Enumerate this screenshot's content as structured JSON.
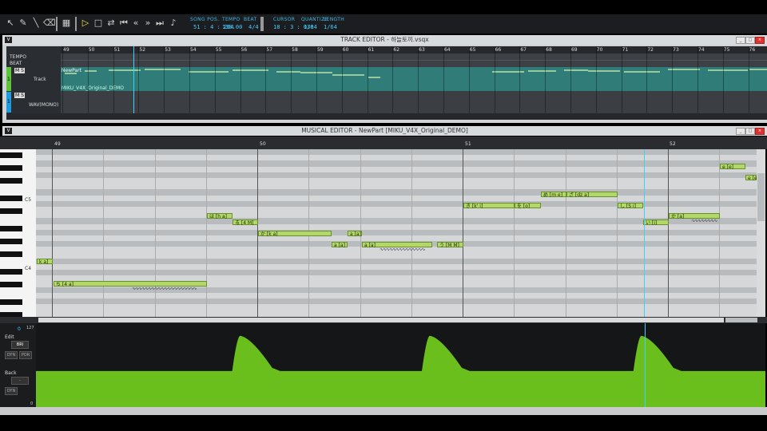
{
  "toolbar": {
    "song_pos_label": "SONG POS.",
    "song_pos_value": "51 : 4 : 264",
    "tempo_label": "TEMPO",
    "tempo_value": "130.00",
    "beat_label": "BEAT",
    "beat_value": "4/4",
    "cursor_label": "CURSOR",
    "cursor_value": "18 : 3 : 030",
    "quantize_label": "QUANTIZE",
    "quantize_value": "1/64",
    "length_label": "LENGTH",
    "length_value": "1/64",
    "icons": [
      "pointer-icon",
      "pencil-icon",
      "line-icon",
      "eraser-icon",
      "grid-icon",
      "play-icon",
      "stop-icon",
      "loop-icon",
      "rewind-icon",
      "back-icon",
      "forward-icon",
      "fast-forward-icon",
      "metronome-icon"
    ]
  },
  "track_editor": {
    "title": "TRACK EDITOR - 하늘토끼.vsqx",
    "v_label": "V",
    "tempo_row": "TEMPO",
    "beat_row": "BEAT",
    "measures": [
      "49",
      "50",
      "51",
      "52",
      "53",
      "54",
      "55",
      "56",
      "57",
      "58",
      "59",
      "60",
      "61",
      "62",
      "63",
      "64",
      "65",
      "66",
      "67",
      "68",
      "69",
      "70",
      "71",
      "72",
      "73",
      "74",
      "75",
      "76"
    ],
    "track1": {
      "number": "1",
      "name": "Track",
      "part_name": "NewPart",
      "singer": "MIKU_V4X_Original_DEMO",
      "ms": "M S"
    },
    "track2": {
      "number": "1",
      "name": "WAV(MONO)",
      "ms": "M S"
    }
  },
  "musical_editor": {
    "title": "MUSICAL EDITOR - NewPart [MIKU_V4X_Original_DEMO]",
    "v_label": "V",
    "measures": [
      "49",
      "50",
      "51",
      "52"
    ],
    "c5_label": "C5",
    "c4_label": "C4",
    "notes": [
      {
        "lyric": "k a]",
        "pitch": 1
      },
      {
        "lyric": "ち [4 a]",
        "pitch": 0
      },
      {
        "lyric": "は [h a]",
        "pitch": 2
      },
      {
        "lyric": "る [4 M]",
        "pitch": 2
      },
      {
        "lyric": "か [k a]",
        "pitch": 2
      },
      {
        "lyric": "a [a]",
        "pitch": 1
      },
      {
        "lyric": "a [a]",
        "pitch": 1
      },
      {
        "lyric": "a [a]",
        "pitch": 1
      },
      {
        "lyric": "う [M M]",
        "pitch": 1
      },
      {
        "lyric": "き [k' i]",
        "pitch": 3
      },
      {
        "lyric": "を [o]",
        "pitch": 3
      },
      {
        "lyric": "め [m e]",
        "pitch": 4
      },
      {
        "lyric": "ざ [dz a]",
        "pitch": 4
      },
      {
        "lyric": "し [S i]",
        "pitch": 3
      },
      {
        "lyric": "い [i]",
        "pitch": 2
      },
      {
        "lyric": "か [a]",
        "pitch": 2
      },
      {
        "lyric": "e [e]",
        "pitch": 5
      },
      {
        "lyric": "e [e]",
        "pitch": 5
      }
    ]
  },
  "control_track": {
    "max_value": "127",
    "min_value": "0",
    "current_value": "0",
    "edit_label": "Edit",
    "edit_param": "BRI",
    "dyn_label": "DYN",
    "por_label": "POR",
    "back_label": "Back",
    "back_param": "-",
    "back_dyn_label": "DYN",
    "baseline_fraction": 0.43,
    "peaks": [
      {
        "measure_pos": 0.28,
        "height_fraction": 0.85
      },
      {
        "measure_pos": 0.54,
        "height_fraction": 0.85
      },
      {
        "measure_pos": 0.83,
        "height_fraction": 0.85
      }
    ]
  },
  "colors": {
    "accent": "#3fd0ff",
    "note_fill": "#b2d86a",
    "track_fill": "#2f7c78",
    "control_fill": "#6bbf1c",
    "play_yellow": "#f0e04a"
  }
}
